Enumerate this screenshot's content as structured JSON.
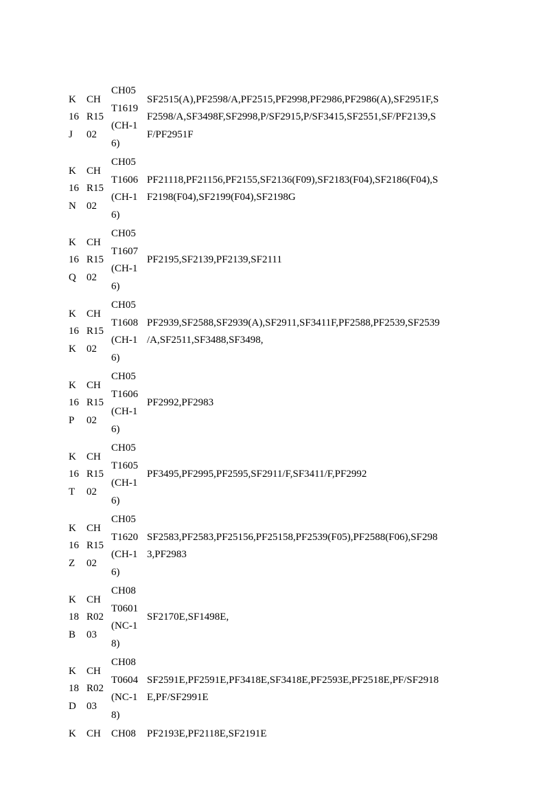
{
  "rows": [
    {
      "c1": "K\n16\nJ",
      "c2": "CH\nR15\n02",
      "c3": "CH05\nT1619\n(CH-1\n6)",
      "c4": "SF2515(A),PF2598/A,PF2515,PF2998,PF2986,PF2986(A),SF2951F,S\nF2598/A,SF3498F,SF2998,P/SF2915,P/SF3415,SF2551,SF/PF2139,S\nF/PF2951F"
    },
    {
      "c1": "K\n16\nN",
      "c2": "CH\nR15\n02",
      "c3": "CH05\nT1606\n(CH-1\n6)",
      "c4": "PF21118,PF21156,PF2155,SF2136(F09),SF2183(F04),SF2186(F04),S\nF2198(F04),SF2199(F04),SF2198G"
    },
    {
      "c1": "K\n16\nQ",
      "c2": "CH\nR15\n02",
      "c3": "CH05\nT1607\n(CH-1\n6)",
      "c4": "PF2195,SF2139,PF2139,SF2111"
    },
    {
      "c1": "K\n16\nK",
      "c2": "CH\nR15\n02",
      "c3": "CH05\nT1608\n(CH-1\n6)",
      "c4": "PF2939,SF2588,SF2939(A),SF2911,SF3411F,PF2588,PF2539,SF2539\n/A,SF2511,SF3488,SF3498,"
    },
    {
      "c1": "K\n16\nP",
      "c2": "CH\nR15\n02",
      "c3": "CH05\nT1606\n(CH-1\n6)",
      "c4": "PF2992,PF2983"
    },
    {
      "c1": "K\n16\nT",
      "c2": "CH\nR15\n02",
      "c3": "CH05\nT1605\n(CH-1\n6)",
      "c4": "PF3495,PF2995,PF2595,SF2911/F,SF3411/F,PF2992"
    },
    {
      "c1": "K\n16\nZ",
      "c2": "CH\nR15\n02",
      "c3": "CH05\nT1620\n(CH-1\n6)",
      "c4": "SF2583,PF2583,PF25156,PF25158,PF2539(F05),PF2588(F06),SF298\n3,PF2983"
    },
    {
      "c1": "K\n18\nB",
      "c2": "CH\nR02\n03",
      "c3": "CH08\nT0601\n(NC-1\n8)",
      "c4": "SF2170E,SF1498E,"
    },
    {
      "c1": "K\n18\nD",
      "c2": "CH\nR02\n03",
      "c3": "CH08\nT0604\n(NC-1\n8)",
      "c4": "SF2591E,PF2591E,PF3418E,SF3418E,PF2593E,PF2518E,PF/SF2918\nE,PF/SF2991E"
    },
    {
      "c1": "K",
      "c2": "CH",
      "c3": "CH08",
      "c4": "PF2193E,PF2118E,SF2191E"
    }
  ]
}
